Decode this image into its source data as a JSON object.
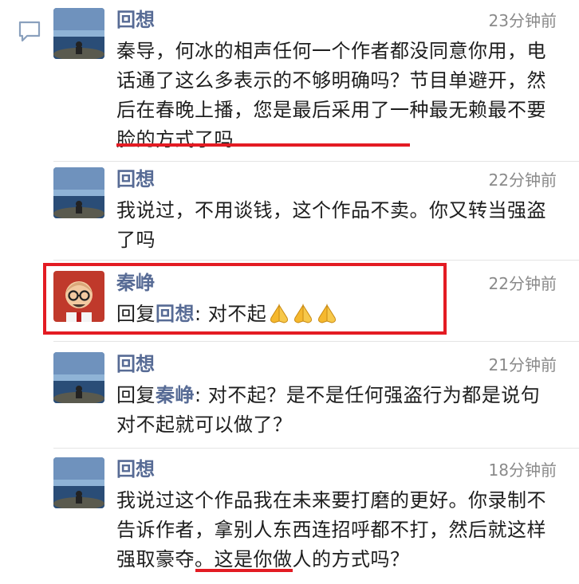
{
  "comments": [
    {
      "author": "回想",
      "time": "23分钟前",
      "text": "秦导，何冰的相声任何一个作者都没同意你用，电话通了这么多表示的不够明确吗？节目单避开，然后在春晚上播，您是最后采用了一种最无赖最不要脸的方式了吗"
    },
    {
      "author": "回想",
      "time": "22分钟前",
      "text": "我说过，不用谈钱，这个作品不卖。你又转当强盗了吗"
    },
    {
      "author": "秦峥",
      "time": "22分钟前",
      "reply_prefix": "回复",
      "reply_to": "回想",
      "text": ": 对不起",
      "emoji": [
        "pray-emoji",
        "pray-emoji",
        "pray-emoji"
      ]
    },
    {
      "author": "回想",
      "time": "21分钟前",
      "reply_prefix": "回复",
      "reply_to": "秦峥",
      "text": ": 对不起？是不是任何强盗行为都是说句对不起就可以做了？"
    },
    {
      "author": "回想",
      "time": "18分钟前",
      "text": "我说过这个作品我在未来要打磨的更好。你录制不告诉作者，拿别人东西连招呼都不打，然后就这样强取豪夺。这是你做人的方式吗？"
    }
  ],
  "colors": {
    "name": "#576b95",
    "highlight": "#e31b23",
    "time": "#8a8a8a"
  },
  "icons": {
    "comment": "comment-bubble-icon"
  }
}
